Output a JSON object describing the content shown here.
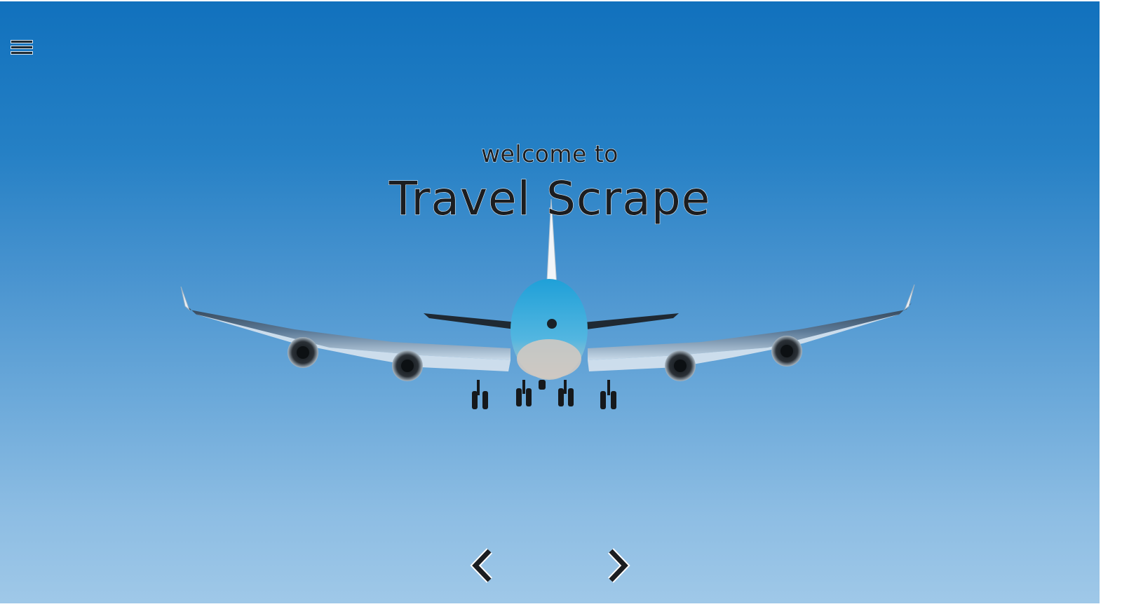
{
  "hero": {
    "welcome_text": "welcome to",
    "title": "Travel Scrape"
  },
  "nav": {
    "menu_icon": "hamburger-menu-icon"
  },
  "carousel": {
    "prev_icon": "chevron-left-icon",
    "next_icon": "chevron-right-icon"
  },
  "colors": {
    "sky_top": "#1171bd",
    "sky_bottom": "#9fc8e8",
    "text": "#1b1d20"
  }
}
